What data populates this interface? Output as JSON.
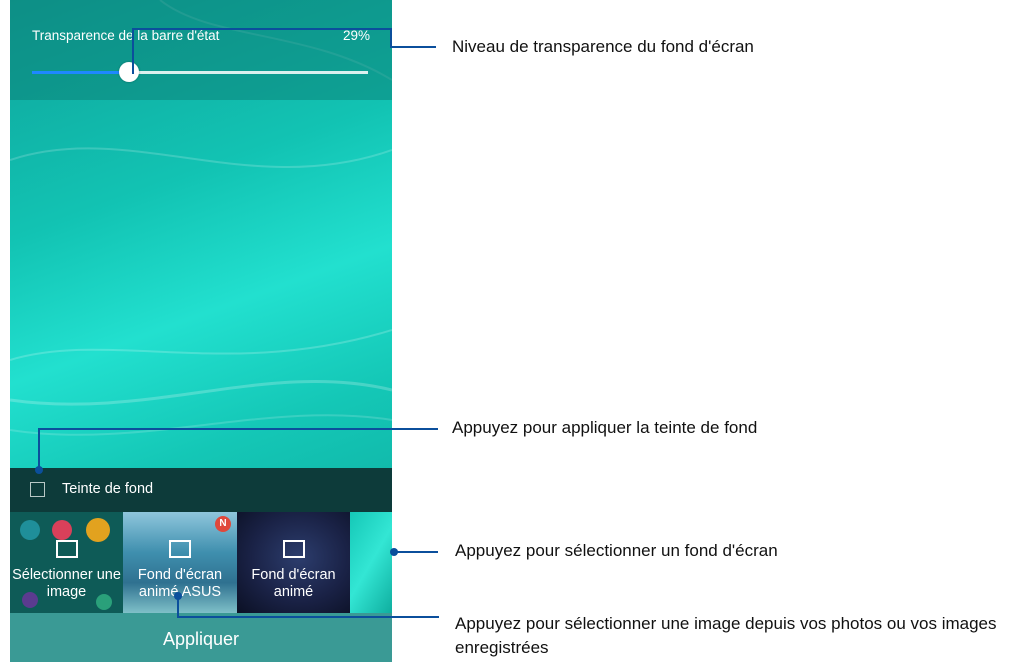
{
  "status_bar_transparency": {
    "label": "Transparence de la barre d'état",
    "value_label": "29%",
    "value": 0.29
  },
  "tint": {
    "label": "Teinte de fond",
    "checked": false
  },
  "wallpapers": [
    {
      "label": "Sélectionner une image",
      "icon": "image-icon"
    },
    {
      "label": "Fond d'écran animé ASUS",
      "icon": "image-icon",
      "badge": "N"
    },
    {
      "label": "Fond d'écran animé",
      "icon": "image-icon"
    }
  ],
  "apply_label": "Appliquer",
  "annotations": [
    "Niveau de transparence du fond d'écran",
    "Appuyez pour appliquer la teinte de fond",
    "Appuyez pour sélectionner un fond d'écran",
    "Appuyez pour sélectionner une image depuis vos photos ou vos images enregistrées"
  ],
  "colors": {
    "annotation_line": "#0b4f9c",
    "slider_fill": "#1e88ff",
    "apply_bg": "#3a9a95"
  }
}
